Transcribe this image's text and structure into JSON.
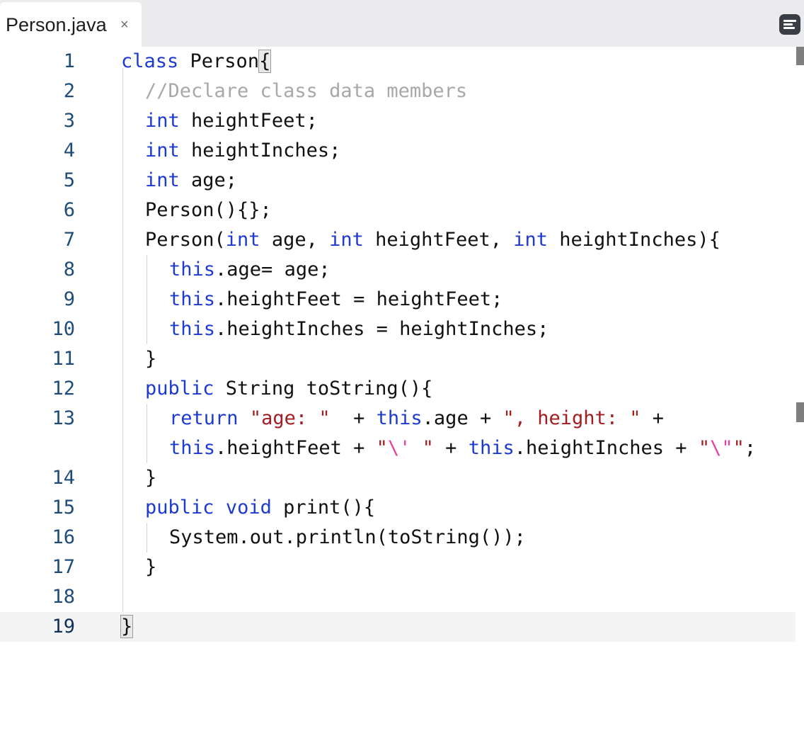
{
  "tab": {
    "filename": "Person.java",
    "close_glyph": "×"
  },
  "menu": {
    "icon": "menu-lines-icon"
  },
  "editor": {
    "line_numbers": [
      "1",
      "2",
      "3",
      "4",
      "5",
      "6",
      "7",
      "8",
      "9",
      "10",
      "11",
      "12",
      "13",
      "14",
      "15",
      "16",
      "17",
      "18",
      "19"
    ],
    "active_line": "19"
  },
  "colors": {
    "keyword": "#1d3bd1",
    "comment": "#a8a8a8",
    "string": "#a31d22",
    "escape": "#e83e9c",
    "line_number": "#1e4d7a"
  },
  "code": {
    "l1": {
      "kw": "class",
      "rest": " Person",
      "brace": "{"
    },
    "l2": {
      "comment": "//Declare class data members"
    },
    "l3": {
      "kw": "int",
      "rest": " heightFeet;"
    },
    "l4": {
      "kw": "int",
      "rest": " heightInches;"
    },
    "l5": {
      "kw": "int",
      "rest": " age;"
    },
    "l6": {
      "text": "Person(){};"
    },
    "l7": {
      "a": "Person(",
      "k1": "int",
      "b": " age, ",
      "k2": "int",
      "c": " heightFeet, ",
      "k3": "int",
      "d": " heightInches){"
    },
    "l8": {
      "kw": "this",
      "rest": ".age= age;"
    },
    "l9": {
      "kw": "this",
      "rest": ".heightFeet = heightFeet;"
    },
    "l10": {
      "kw": "this",
      "rest": ".heightInches = heightInches;"
    },
    "l11": {
      "text": "}"
    },
    "l12": {
      "kw": "public",
      "rest": " String toString(){"
    },
    "l13": {
      "kw1": "return",
      "sp": " ",
      "s1": "\"age: \"",
      "b": "  + ",
      "kw2": "this",
      "c": ".age + ",
      "s2": "\", height: \"",
      "d": " +"
    },
    "l13b": {
      "kw1": "this",
      "a": ".heightFeet + ",
      "q1": "\"",
      "e1": "\\'",
      "q2": " \"",
      "b": " + ",
      "kw2": "this",
      "c": ".heightInches + ",
      "q3": "\"",
      "e2": "\\\"",
      "q4": "\"",
      "d": ";"
    },
    "l14": {
      "text": "}"
    },
    "l15": {
      "kw1": "public",
      "sp": " ",
      "kw2": "void",
      "rest": " print(){"
    },
    "l16": {
      "text": "System.out.println(toString());"
    },
    "l17": {
      "text": "}"
    },
    "l19": {
      "brace": "}"
    }
  }
}
